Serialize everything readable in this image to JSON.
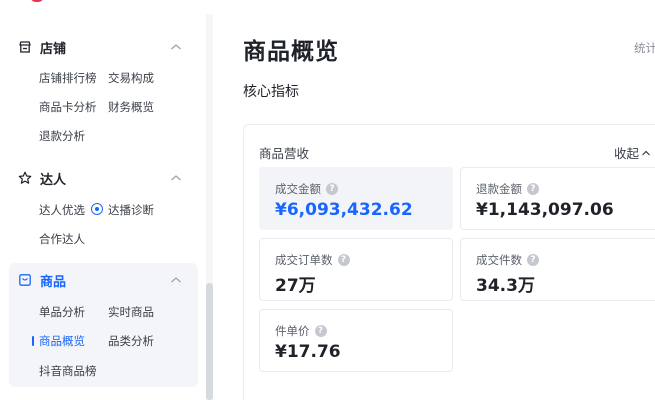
{
  "sidebar": {
    "sections": [
      {
        "title": "店铺",
        "icon": "shop-icon",
        "items": [
          "店铺排行榜",
          "交易构成",
          "商品卡分析",
          "财务概览",
          "退款分析"
        ]
      },
      {
        "title": "达人",
        "icon": "star-icon",
        "items": [
          "达人优选",
          "达播诊断",
          "合作达人"
        ]
      },
      {
        "title": "商品",
        "icon": "product-box-icon",
        "items": [
          "单品分析",
          "实时商品",
          "商品概览",
          "品类分析",
          "抖音商品榜"
        ]
      }
    ],
    "active_item": "商品概览",
    "colors": {
      "accent": "#1966ff",
      "active_bg": "#f3f5f9"
    }
  },
  "main": {
    "title": "商品概览",
    "top_right_link": "统计",
    "section_title": "核心指标",
    "panel": {
      "title": "商品营收",
      "collapse_label": "收起",
      "metrics": [
        {
          "label": "成交金额",
          "value": "¥6,093,432.62",
          "selected": true
        },
        {
          "label": "退款金额",
          "value": "¥1,143,097.06"
        },
        {
          "label": "成交订单数",
          "value": "27万"
        },
        {
          "label": "成交件数",
          "value": "34.3万"
        },
        {
          "label": "件单价",
          "value": "¥17.76"
        }
      ]
    }
  }
}
